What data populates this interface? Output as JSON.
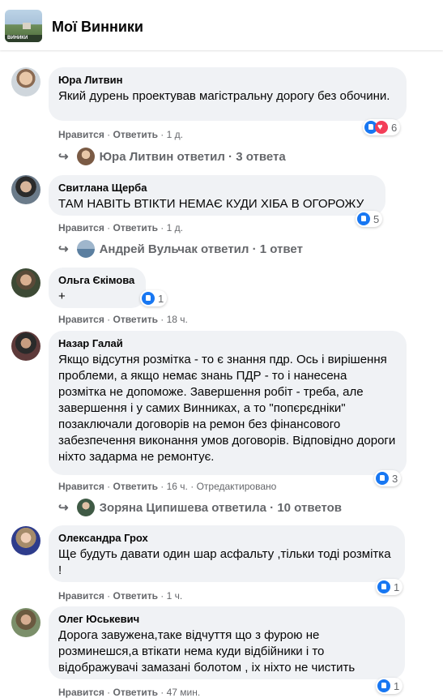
{
  "header": {
    "title": "Мої Винники",
    "thumb_label": "ВИНИКИ"
  },
  "comments": [
    {
      "name": "Юра Литвин",
      "text": "Який дурень проектував магістральну дорогу без обочини.",
      "like": "Нравится",
      "reply": "Ответить",
      "time": "1 д.",
      "edited": "",
      "reactions": "6",
      "replies": "Юра Литвин ответил · 3 ответа"
    },
    {
      "name": "Свитлана Щерба",
      "text": "ТАМ НАВІТЬ ВТІКТИ НЕМАЄ КУДИ ХІБА В ОГОРОЖУ",
      "like": "Нравится",
      "reply": "Ответить",
      "time": "1 д.",
      "edited": "",
      "reactions": "5",
      "replies": "Андрей Вульчак ответил · 1 ответ"
    },
    {
      "name": "Ольга Єкімова",
      "text": "+",
      "like": "Нравится",
      "reply": "Ответить",
      "time": "18 ч.",
      "edited": "",
      "reactions": "1",
      "replies": ""
    },
    {
      "name": "Назар Галай",
      "text": "Якщо відсутня розмітка - то є знання пдр. Ось і вирішення проблеми, а якщо немає знань ПДР - то і нанесена розмітка не допоможе. Завершення робіт - треба, але завершення і у самих Винниках, а то \"попєрєдніки\" позаключали договорів на ремон без фінансового забезпечення виконання умов договорів. Відповідно дороги ніхто задарма не ремонтує.",
      "like": "Нравится",
      "reply": "Ответить",
      "time": "16 ч.",
      "edited": "Отредактировано",
      "reactions": "3",
      "replies": "Зоряна Ципишева ответила · 10 ответов"
    },
    {
      "name": "Олександра Грох",
      "text": "Ще будуть давати один шар асфальту ,тільки тоді розмітка !",
      "like": "Нравится",
      "reply": "Ответить",
      "time": "1 ч.",
      "edited": "",
      "reactions": "1",
      "replies": ""
    },
    {
      "name": "Олег Юськевич",
      "text": "Дорога завужена,таке відчуття що з фурою не розминешся,а втікати нема куди відбійники і то відображувачі замазані болотом , іх ніхто не чистить",
      "like": "Нравится",
      "reply": "Ответить",
      "time": "47 мин.",
      "edited": "",
      "reactions": "1",
      "replies": ""
    }
  ],
  "colors": {
    "like_blue": "#1877f2",
    "love_red": "#f33e58",
    "bubble": "#f0f2f5",
    "meta": "#65676b"
  }
}
